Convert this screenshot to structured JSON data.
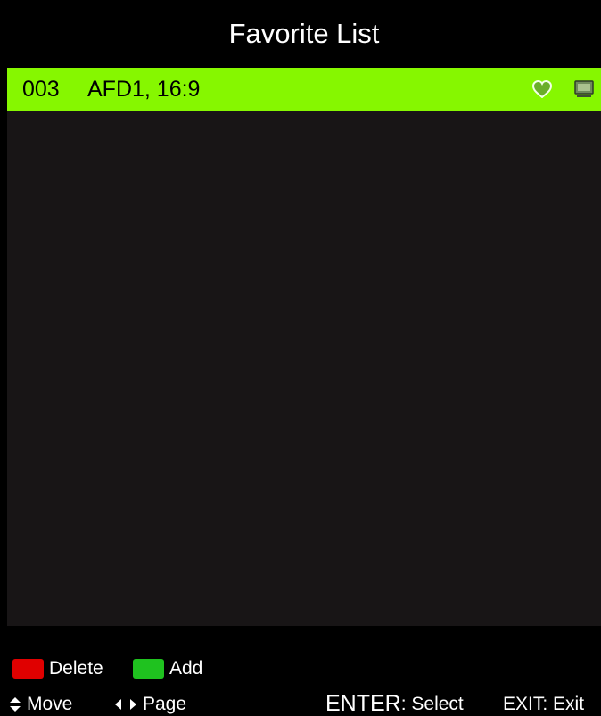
{
  "title": "Favorite List",
  "channels": [
    {
      "number": "003",
      "name": "AFD1, 16:9",
      "favorite_icon": "heart-icon",
      "type_icon": "tv-icon"
    }
  ],
  "colors": {
    "highlight": "#86f700",
    "list_background": "#181516",
    "delete_key": "#e00000",
    "add_key": "#1fc21f"
  },
  "footer": {
    "delete_label": "Delete",
    "add_label": "Add",
    "move_label": "Move",
    "page_label": "Page",
    "enter_key": "ENTER",
    "enter_action": ": Select",
    "exit_label": "EXIT: Exit"
  }
}
